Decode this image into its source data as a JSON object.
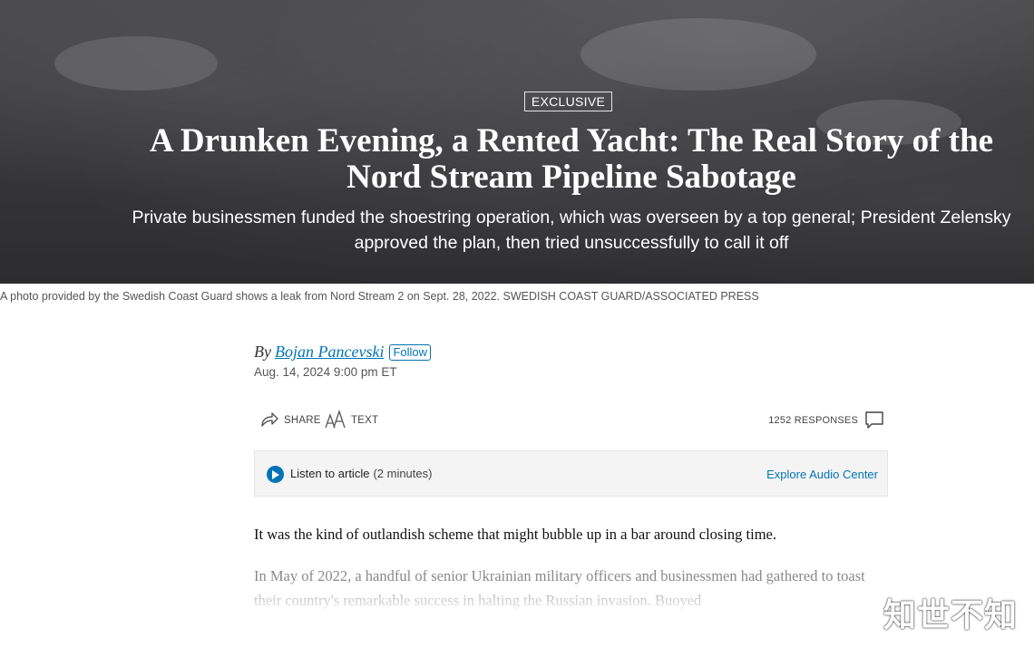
{
  "hero": {
    "badge": "EXCLUSIVE",
    "headline": "A Drunken Evening, a Rented Yacht: The Real Story of the Nord Stream Pipeline Sabotage",
    "dek": "Private businessmen funded the shoestring operation, which was overseen by a top general; President Zelensky approved the plan, then tried unsuccessfully to call it off"
  },
  "caption": "A photo provided by the Swedish Coast Guard shows a leak from Nord Stream 2 on Sept. 28, 2022. SWEDISH COAST GUARD/ASSOCIATED PRESS",
  "byline": {
    "prefix": "By",
    "author": "Bojan Pancevski",
    "follow_label": "Follow",
    "date": "Aug. 14, 2024 9:00 pm ET"
  },
  "toolbar": {
    "share_label": "SHARE",
    "text_label": "TEXT",
    "responses_label": "1252 RESPONSES",
    "share_icon": "share-arrow-icon",
    "text_icon": "text-size-icon",
    "comment_icon": "speech-bubble-icon"
  },
  "audio": {
    "listen_label": "Listen to article",
    "duration": "(2 minutes)",
    "explore_label": "Explore Audio Center",
    "play_icon": "play-icon"
  },
  "article": {
    "p1": "It was the kind of outlandish scheme that might bubble up in a bar around closing time.",
    "p2": "In May of 2022, a handful of senior Ukrainian military officers and businessmen had gathered to toast their country's remarkable success in halting the Russian invasion. Buoyed"
  },
  "watermark": "知世不知",
  "colors": {
    "link": "#0274b6",
    "hero_background": "#3a3a3d",
    "text": "#222222"
  }
}
